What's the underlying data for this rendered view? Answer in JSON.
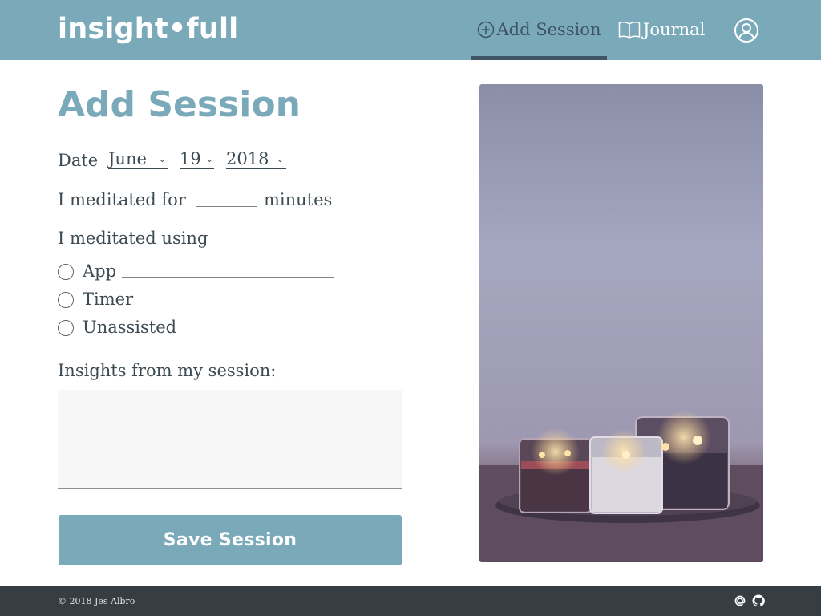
{
  "header": {
    "logo_text": "insight•full",
    "nav": {
      "add_session_label": "Add Session",
      "journal_label": "Journal"
    },
    "active_nav": "add_session",
    "background_color": "#7aaab9"
  },
  "form": {
    "title": "Add Session",
    "date": {
      "label": "Date",
      "month": "June",
      "day": "19",
      "year": "2018"
    },
    "duration": {
      "prefix": "I meditated for",
      "value": "",
      "suffix": "minutes"
    },
    "method": {
      "label": "I meditated using",
      "options": [
        {
          "label": "App",
          "selected": false
        },
        {
          "label": "Timer",
          "selected": false
        },
        {
          "label": "Unassisted",
          "selected": false
        }
      ],
      "app_name_value": ""
    },
    "insights": {
      "label": "Insights from my session:",
      "value": ""
    },
    "save_label": "Save Session"
  },
  "photo": {
    "subject": "three lit candles in glass jars on a dark tray"
  },
  "footer": {
    "copyright": "© 2018 Jes Albro",
    "icons": [
      "at-icon",
      "github-icon"
    ]
  },
  "colors": {
    "accent": "#7aaab9",
    "nav_active": "#3f5566",
    "footer_bg": "#363d43",
    "text": "#3d4a52"
  }
}
